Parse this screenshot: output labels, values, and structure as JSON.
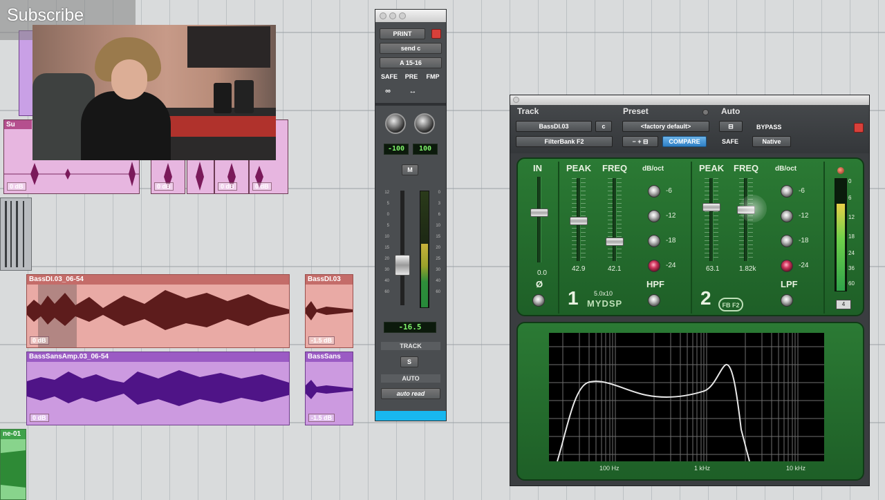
{
  "overlay": {
    "subscribe_label": "Subscribe"
  },
  "tracks": {
    "regions": [
      {
        "name": "Su",
        "gain": "0 dB"
      },
      {
        "gain": "0 dB"
      },
      {
        "gain": "0 dB"
      },
      {
        "gain": "0 dB"
      }
    ],
    "clips": [
      {
        "name": "BassDI.03_06-54",
        "gain": "0 dB"
      },
      {
        "name": "BassDI.03",
        "gain": "-1.5 dB"
      },
      {
        "name": "BassSansAmp.03_06-54",
        "gain": "0 dB"
      },
      {
        "name": "BassSans",
        "gain": "-1.5 dB"
      },
      {
        "name": "ne-01"
      }
    ]
  },
  "mixer": {
    "print_label": "PRINT",
    "send_label": "send c",
    "io_label": "A 15-16",
    "safe_label": "SAFE",
    "pre_label": "PRE",
    "fmp_label": "FMP",
    "pan_left": "-100",
    "pan_right": "100",
    "mute_label": "M",
    "fader_value": "-16.5",
    "track_section": "TRACK",
    "solo_label": "S",
    "auto_section": "AUTO",
    "auto_mode": "auto read",
    "fader_scale": [
      "12",
      "5",
      "0",
      "5",
      "10",
      "15",
      "20",
      "30",
      "40",
      "60"
    ],
    "meter_scale": [
      "0",
      "3",
      "6",
      "10",
      "15",
      "20",
      "25",
      "30",
      "40",
      "60"
    ],
    "meter_level": 0.55
  },
  "plugin": {
    "track_label": "Track",
    "preset_label": "Preset",
    "auto_label": "Auto",
    "track_name": "BassDI.03",
    "track_channel": "c",
    "plugin_name": "FilterBank F2",
    "preset_name": "<factory default>",
    "compare_label": "COMPARE",
    "safe_label": "SAFE",
    "bypass_label": "BYPASS",
    "native_label": "Native",
    "panel": {
      "in_label": "IN",
      "in_value": "0.0",
      "phase_label": "Ø",
      "band1_peak_label": "PEAK",
      "band1_freq_label": "FREQ",
      "band1_dboct_label": "dB/oct",
      "band1_peak_value": "42.9",
      "band1_freq_value": "42.1",
      "band1_number": "1",
      "band1_version": "5.0x10",
      "band1_brand": "MYDSP",
      "band1_filter_label": "HPF",
      "band2_peak_label": "PEAK",
      "band2_freq_label": "FREQ",
      "band2_dboct_label": "dB/oct",
      "band2_peak_value": "63.1",
      "band2_freq_value": "1.82k",
      "band2_number": "2",
      "band2_brand": "FB F2",
      "band2_filter_label": "LPF",
      "slopes": [
        "-6",
        "-12",
        "-18",
        "-24"
      ],
      "band1_selected_slope": "-24",
      "band2_selected_slope": "-24",
      "out_scale": [
        "0",
        "6",
        "12",
        "18",
        "24",
        "36",
        "60"
      ],
      "out_readout": "4",
      "out_level": 0.78
    },
    "graph_labels": [
      "100 Hz",
      "1 kHz",
      "10 kHz"
    ]
  }
}
